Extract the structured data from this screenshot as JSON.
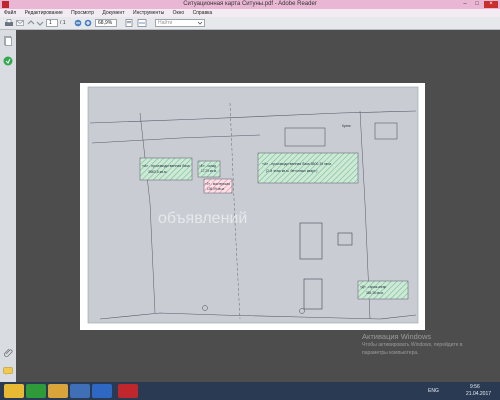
{
  "window": {
    "title": "Ситуационная карта Ситуны.pdf - Adobe Reader",
    "controls": [
      "–",
      "□",
      "×"
    ]
  },
  "menu": [
    "Файл",
    "Редактирование",
    "Просмотр",
    "Документ",
    "Инструменты",
    "Окно",
    "Справка"
  ],
  "toolbar": {
    "page_current": "1",
    "page_total": "/ 1",
    "zoom": "68,9%",
    "search_placeholder": "Найти"
  },
  "document": {
    "labels": {
      "label_a": "«А» - производственная база\n3863,5 кв.м.",
      "label_b": "«Б» - склад\n17,29 кв.м.",
      "label_c": "«Г» - мастерская\n136,09 кв.м.",
      "label_d": "«А» - производственная база 5800,39 кв.м.\n(2-й этаж кв.м. бетонных кварт.)",
      "label_e": "«Д» - гараж-ангар\n385,38 кв.м.",
      "label_f": "Кухня"
    },
    "watermark": "объявлений"
  },
  "activation": {
    "line1": "Активация Windows",
    "line2": "Чтобы активировать Windows, перейдите в",
    "line3": "параметры компьютера."
  },
  "tray": {
    "lang": "ENG",
    "time": "9:56",
    "date": "21.04.2017"
  },
  "colors": {
    "titlebar": "#e9b7d4",
    "taskbar": "#2a3a52",
    "hatch_green": "#8fd3a6",
    "hatch_red": "#f0a6b4"
  }
}
